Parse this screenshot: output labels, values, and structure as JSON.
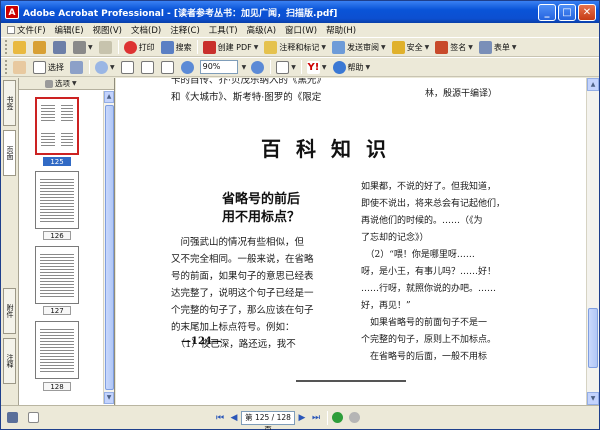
{
  "window": {
    "title": "Adobe Acrobat Professional - [读者参考丛书：加见广闻，扫描版.pdf]",
    "app_icon_letter": "A"
  },
  "menu": {
    "items": [
      "文件(F)",
      "编辑(E)",
      "视图(V)",
      "文档(D)",
      "注释(C)",
      "工具(T)",
      "高级(A)",
      "窗口(W)",
      "帮助(H)"
    ]
  },
  "toolbar1": {
    "print_label": "打印",
    "search_label": "搜索",
    "create_pdf_label": "创建 PDF",
    "review_label": "注释和标记",
    "send_label": "发送审阅",
    "secure_label": "安全",
    "sign_label": "签名",
    "forms_label": "表单"
  },
  "toolbar2": {
    "select_label": "选择",
    "zoom_value": "90%",
    "help_label": "帮助"
  },
  "left_panel": {
    "strip_tabs": [
      "书签",
      "页面",
      "附件",
      "注释"
    ],
    "options_label": "选项",
    "thumbnails": [
      {
        "label": "125",
        "selected": true
      },
      {
        "label": "126",
        "selected": false
      },
      {
        "label": "127",
        "selected": false
      },
      {
        "label": "128",
        "selected": false
      }
    ]
  },
  "document": {
    "top_left_lines": [
      "卡的自传、乔·贝茂乐纳入的《黑光》",
      "和《大城市》、斯考特·图罗的《限定"
    ],
    "top_right_line": "林，殷源干编译）",
    "section_title": "百科知识",
    "article_title_1": "省略号的前后",
    "article_title_2": "用不用标点？",
    "left_column": [
      "　问强武山的情况有些相似，但",
      "又不完全相同。一般来说，在省略",
      "号的前面，如果句子的意思已经表",
      "达完整了，说明这个句子已经是一",
      "个完整的句子了，那么应该在句子",
      "的末尾加上标点符号。例如：",
      "　（1）夜已深，路还远，我不"
    ],
    "right_column": [
      "如果都，不说的好了。但我知道，",
      "即使不说出，将来总会有记起他们，",
      "再说他们的时候的。……（《为",
      "了忘却的记念》）",
      "　（2）“喂！你是哪里呀……",
      "呀，是小王，有事儿吗？……好！",
      "……行呀，就照你说的办吧。……",
      "好，再见！”",
      "　如果省略号的前面句子不是一",
      "个完整的句子，原则上不加标点。",
      "　在省略号的后面，一般不用标"
    ],
    "page_number": "—124—"
  },
  "status": {
    "page_display": "第 125 / 128 页"
  },
  "colors": {
    "titlebar": "#0a54d8",
    "chrome": "#ece9d8",
    "selected_thumb_border": "#cc2222"
  }
}
